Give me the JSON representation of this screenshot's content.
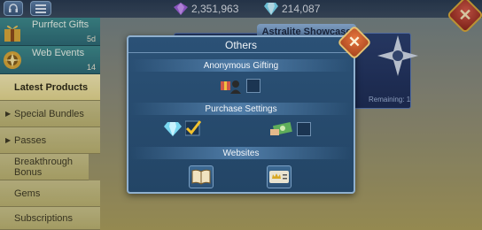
{
  "resources": {
    "gems_left": "2,351,963",
    "gems_right": "214,087"
  },
  "sidebar": {
    "featured": [
      {
        "title": "Purrfect Gifts",
        "sub": "5d"
      },
      {
        "title": "Web Events",
        "sub": "14"
      }
    ],
    "items": [
      {
        "label": "Latest Products",
        "active": true
      },
      {
        "label": "Special Bundles",
        "expandable": true
      },
      {
        "label": "Passes",
        "expandable": true
      },
      {
        "label": "Breakthrough Bonus"
      },
      {
        "label": "Gems"
      },
      {
        "label": "Subscriptions"
      }
    ]
  },
  "background": {
    "showcase_tab": "Astralite Showcase",
    "showcase_foot": "Remaining: 1"
  },
  "dialog": {
    "title": "Others",
    "sections": {
      "anonymous": "Anonymous Gifting",
      "purchase": "Purchase Settings",
      "websites": "Websites"
    },
    "close_symbol": "✕"
  },
  "top_close_symbol": "✕",
  "colors": {
    "accent": "#e6763d",
    "dialog_bg": "#2b5176",
    "checkmark": "#f2c22e"
  }
}
